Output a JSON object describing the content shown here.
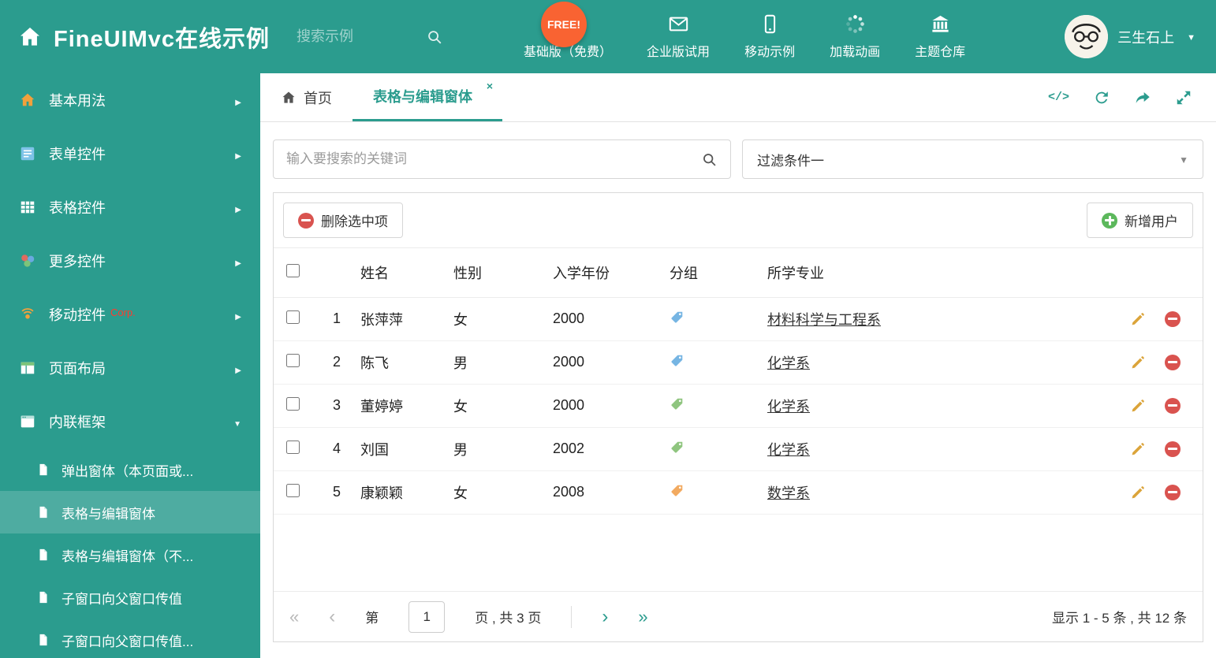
{
  "colors": {
    "theme_teal": "#2b9c8e",
    "free_badge_orange": "#f96332",
    "delete_red": "#d9534f",
    "add_green": "#5cb85c",
    "edit_yellow": "#dba43a",
    "tag_blue": "#76b5e3",
    "tag_green": "#8fc57f",
    "tag_orange": "#f2aa60"
  },
  "header": {
    "title": "FineUIMvc在线示例",
    "search_placeholder": "搜索示例",
    "free_badge": "FREE!",
    "nav": [
      {
        "label": "基础版（免费）"
      },
      {
        "label": "企业版试用"
      },
      {
        "label": "移动示例"
      },
      {
        "label": "加载动画"
      },
      {
        "label": "主题仓库"
      }
    ],
    "user_name": "三生石上"
  },
  "sidebar": {
    "items": [
      {
        "label": "基本用法"
      },
      {
        "label": "表单控件"
      },
      {
        "label": "表格控件"
      },
      {
        "label": "更多控件"
      },
      {
        "label": "移动控件",
        "badge": "Corp."
      },
      {
        "label": "页面布局"
      },
      {
        "label": "内联框架"
      }
    ],
    "subitems": [
      {
        "label": "弹出窗体（本页面或..."
      },
      {
        "label": "表格与编辑窗体"
      },
      {
        "label": "表格与编辑窗体（不..."
      },
      {
        "label": "子窗口向父窗口传值"
      },
      {
        "label": "子窗口向父窗口传值..."
      }
    ]
  },
  "tabs": [
    {
      "label": "首页"
    },
    {
      "label": "表格与编辑窗体"
    }
  ],
  "filter": {
    "search_placeholder": "输入要搜索的关键词",
    "dropdown_value": "过滤条件一"
  },
  "toolbar": {
    "delete_label": "删除选中项",
    "add_label": "新增用户"
  },
  "table": {
    "headers": [
      "姓名",
      "性别",
      "入学年份",
      "分组",
      "所学专业"
    ],
    "rows": [
      {
        "num": "1",
        "name": "张萍萍",
        "gender": "女",
        "year": "2000",
        "tag": "blue",
        "major": "材料科学与工程系"
      },
      {
        "num": "2",
        "name": "陈飞",
        "gender": "男",
        "year": "2000",
        "tag": "blue",
        "major": "化学系"
      },
      {
        "num": "3",
        "name": "董婷婷",
        "gender": "女",
        "year": "2000",
        "tag": "green",
        "major": "化学系"
      },
      {
        "num": "4",
        "name": "刘国",
        "gender": "男",
        "year": "2002",
        "tag": "green",
        "major": "化学系"
      },
      {
        "num": "5",
        "name": "康颖颖",
        "gender": "女",
        "year": "2008",
        "tag": "orange",
        "major": "数学系"
      }
    ]
  },
  "pagination": {
    "page_label_before": "第",
    "page": "1",
    "page_label_after": "页 , 共 3 页",
    "summary": "显示 1 - 5 条 , 共 12 条"
  }
}
